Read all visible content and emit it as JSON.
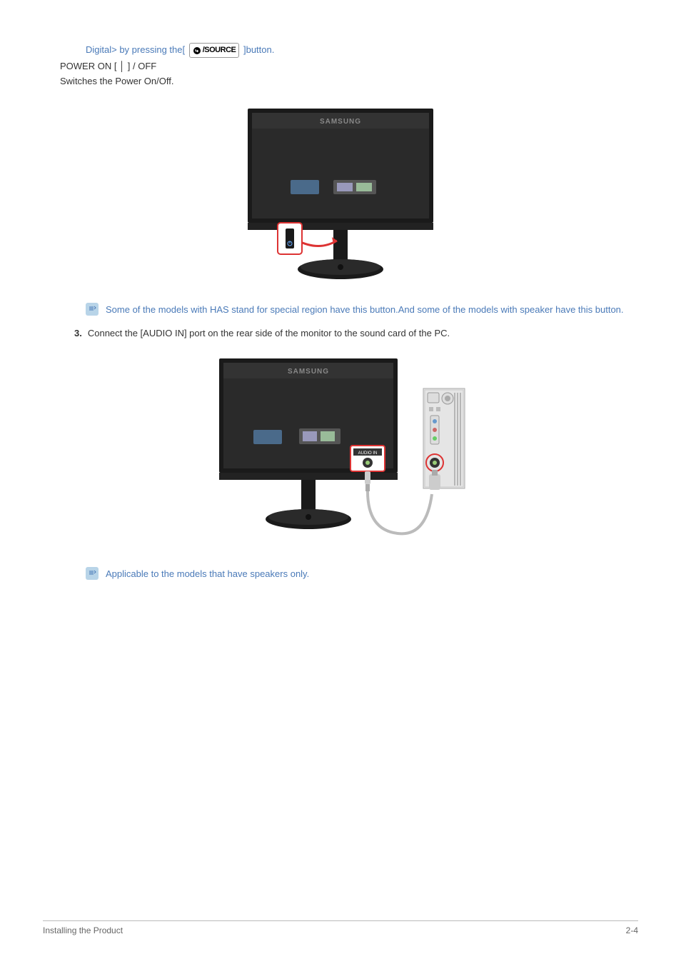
{
  "top": {
    "fragment_prefix": "Digital> by pressing the[",
    "fragment_suffix": "]button.",
    "source_label": "/SOURCE",
    "power_line": "POWER ON [ │ ] / OFF",
    "switch_line": "Switches the Power On/Off."
  },
  "fig1_logo": "SAMSUNG",
  "note1": "Some of the models with HAS stand for special region  have this button.And some of the models with speaker have this button.",
  "step3": {
    "number": "3.",
    "text": "Connect the [AUDIO IN] port on the rear side of the monitor to the sound card of the PC."
  },
  "fig2_logo": "SAMSUNG",
  "fig2_port_label": "AUDIO IN",
  "note2": "Applicable to the models that have speakers only.",
  "footer": {
    "section": "Installing the Product",
    "page": "2-4"
  }
}
